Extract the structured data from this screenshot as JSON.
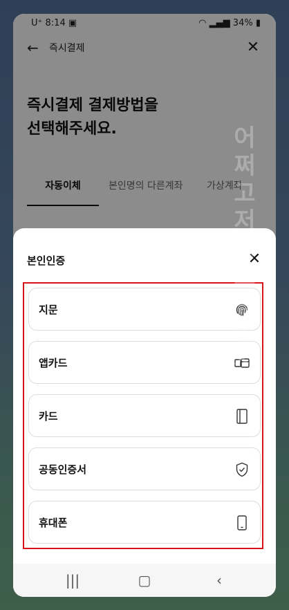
{
  "status_bar": {
    "carrier": "U⁺",
    "time": "8:14",
    "battery": "34%"
  },
  "header": {
    "title": "즉시결제",
    "heading": "즉시결제 결제방법을\n선택해주세요."
  },
  "tabs": [
    {
      "label": "자동이체",
      "active": true
    },
    {
      "label": "본인명의 다른계좌",
      "active": false
    },
    {
      "label": "가상계좌",
      "active": false
    }
  ],
  "sheet": {
    "title": "본인인증",
    "options": [
      {
        "label": "지문",
        "icon": "fingerprint-icon"
      },
      {
        "label": "앱카드",
        "icon": "app-card-icon"
      },
      {
        "label": "카드",
        "icon": "card-icon"
      },
      {
        "label": "공동인증서",
        "icon": "shield-check-icon"
      },
      {
        "label": "휴대폰",
        "icon": "mobile-phone-icon"
      }
    ]
  },
  "watermark": "어쩌고저쩌고 실험지",
  "colors": {
    "highlight": "#d8141b",
    "dim_overlay": "rgba(0,0,0,0.45)"
  }
}
